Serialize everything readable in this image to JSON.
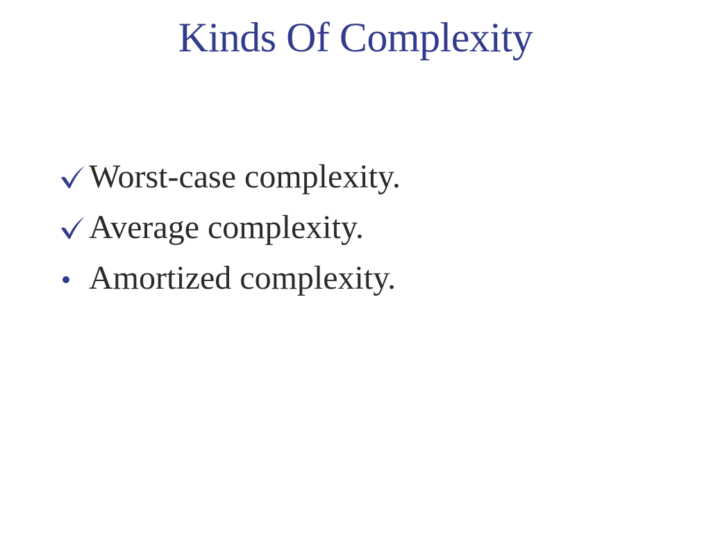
{
  "slide": {
    "title": "Kinds Of Complexity",
    "bullets": [
      {
        "marker": "check-icon",
        "text": "Worst-case complexity."
      },
      {
        "marker": "check-icon",
        "text": "Average complexity."
      },
      {
        "marker": "dot-icon",
        "text": "Amortized complexity."
      }
    ]
  },
  "colors": {
    "accent": "#333c8c",
    "body_text": "#2a2a2a",
    "background": "#ffffff"
  }
}
